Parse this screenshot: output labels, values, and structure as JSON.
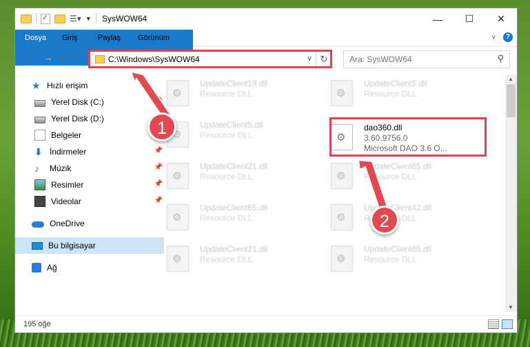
{
  "window": {
    "title": "SysWOW64"
  },
  "ribbon": {
    "tabs": [
      "Dosya",
      "Giriş",
      "Paylaş",
      "Görünüm"
    ],
    "help_label": "?"
  },
  "address": {
    "path": "C:\\Windows\\SysWOW64",
    "search_placeholder": "Ara: SysWOW64"
  },
  "sidebar": {
    "quick_access": "Hızlı erişim",
    "items": [
      {
        "label": "Yerel Disk (C:)",
        "icon": "drive-icon",
        "pinned": true
      },
      {
        "label": "Yerel Disk (D:)",
        "icon": "drive-icon",
        "pinned": true
      },
      {
        "label": "Belgeler",
        "icon": "documents-icon",
        "pinned": true
      },
      {
        "label": "İndirmeler",
        "icon": "downloads-icon",
        "pinned": true
      },
      {
        "label": "Müzik",
        "icon": "music-icon",
        "pinned": true
      },
      {
        "label": "Resimler",
        "icon": "pictures-icon",
        "pinned": true
      },
      {
        "label": "Videolar",
        "icon": "videos-icon",
        "pinned": true
      }
    ],
    "onedrive": "OneDrive",
    "this_pc": "Bu bilgisayar",
    "network": "Ağ"
  },
  "files": {
    "left": [
      {
        "name": "UpdateClient19.dll",
        "type": "Resource DLL"
      },
      {
        "name": "UpdateClient5.dll",
        "type": "Resource DLL"
      },
      {
        "name": "UpdateClient21.dll",
        "type": "Resource DLL"
      },
      {
        "name": "UpdateClient65.dll",
        "type": "Resource DLL"
      },
      {
        "name": "UpdateClient21.dll",
        "type": "Resource DLL"
      }
    ],
    "right": [
      {
        "name": "UpdateClient5.dll",
        "type": "Resource DLL"
      },
      {
        "name": "dao360.dll",
        "type": "3.60.9756.0",
        "desc": "Microsoft DAO 3.6 O..."
      },
      {
        "name": "UpdateClient65.dll",
        "type": "Resource DLL"
      },
      {
        "name": "UpdateClient42.dll",
        "type": "Resource DLL"
      },
      {
        "name": "UpdateClient65.dll",
        "type": "Resource DLL"
      }
    ]
  },
  "status": {
    "count": "195 öğe"
  },
  "annotations": {
    "badge1": "1",
    "badge2": "2",
    "color": "#e2484f"
  }
}
